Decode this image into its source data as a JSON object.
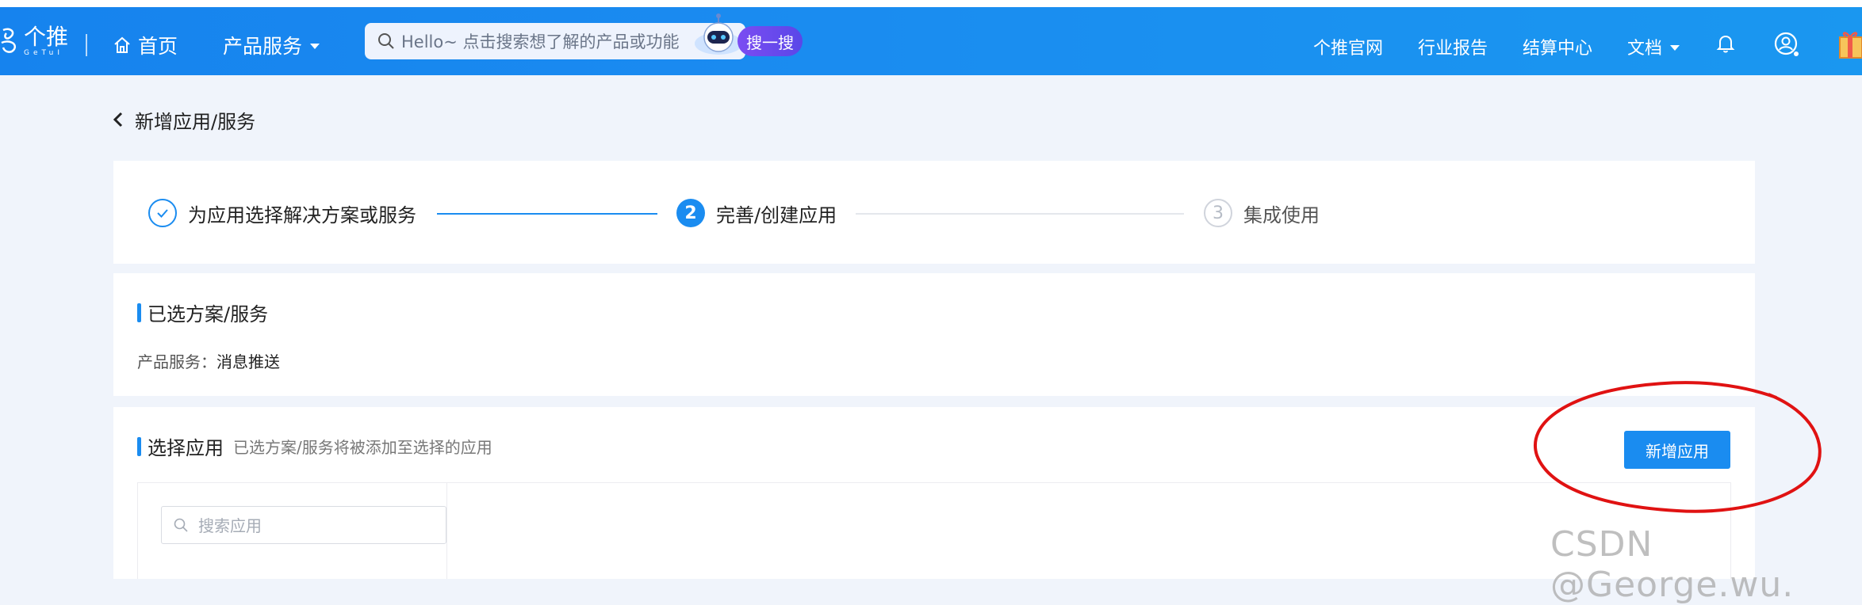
{
  "nav": {
    "logo_cn": "个推",
    "logo_en": "GeTuI",
    "home": "首页",
    "products": "产品服务",
    "search_placeholder": "Hello~ 点击搜索想了解的产品或功能",
    "search_button": "搜一搜",
    "links": [
      "个推官网",
      "行业报告",
      "结算中心",
      "文档"
    ],
    "icons": [
      "bell-icon",
      "user-circle-icon",
      "gift-icon"
    ]
  },
  "breadcrumb": {
    "back_label": "新增应用/服务"
  },
  "steps": [
    {
      "number": "1",
      "label": "为应用选择解决方案或服务",
      "status": "done"
    },
    {
      "number": "2",
      "label": "完善/创建应用",
      "status": "active"
    },
    {
      "number": "3",
      "label": "集成使用",
      "status": "wait"
    }
  ],
  "selected": {
    "title": "已选方案/服务",
    "product_label": "产品服务：",
    "product_value": "消息推送"
  },
  "choose": {
    "title": "选择应用",
    "subtitle": "已选方案/服务将被添加至选择的应用",
    "add_button": "新增应用",
    "search_placeholder": "搜索应用"
  },
  "watermark": "CSDN @George.wu.",
  "colors": {
    "primary": "#1a8cf0",
    "annotation": "#e01212",
    "search_button": "#6a4aee"
  }
}
